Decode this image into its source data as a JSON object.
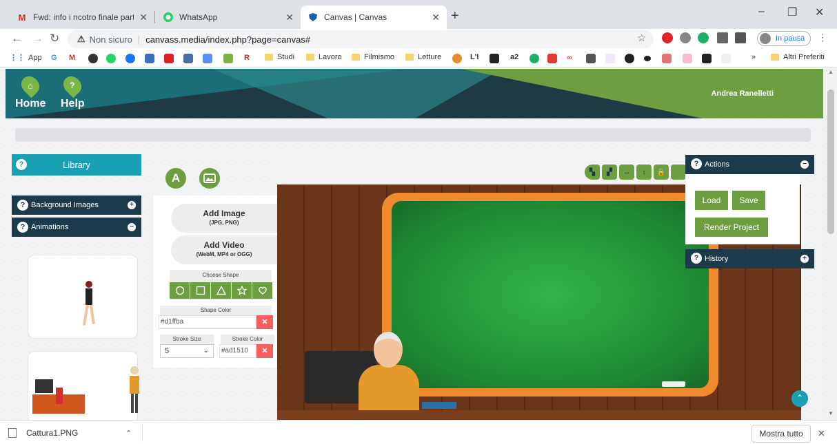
{
  "browser": {
    "tabs": [
      {
        "title": "Fwd: info i ncotro finale partner ;",
        "icon": "gmail-icon",
        "active": false
      },
      {
        "title": "WhatsApp",
        "icon": "whatsapp-icon",
        "active": false
      },
      {
        "title": "Canvas | Canvas",
        "icon": "shield-icon",
        "active": true
      }
    ],
    "new_tab": "+",
    "window_controls": {
      "minimize": "–",
      "restore": "❐",
      "close": "✕"
    },
    "address": {
      "security": "Non sicuro",
      "url": "canvass.media/index.php?page=canvas#"
    },
    "profile_label": "In pausa",
    "bookmarks": [
      {
        "label": "App",
        "type": "apps"
      },
      {
        "label": "Studi",
        "type": "folder"
      },
      {
        "label": "Lavoro",
        "type": "folder"
      },
      {
        "label": "Filmismo",
        "type": "folder"
      },
      {
        "label": "Letture",
        "type": "folder"
      },
      {
        "label": "L'I",
        "type": "site"
      },
      {
        "label": "a2",
        "type": "site"
      },
      {
        "label": "»",
        "type": "more"
      },
      {
        "label": "Altri Preferiti",
        "type": "folder"
      }
    ]
  },
  "header": {
    "nav": [
      {
        "label": "Home",
        "icon": "home-icon",
        "glyph": "⌂"
      },
      {
        "label": "Help",
        "icon": "help-icon",
        "glyph": "?"
      }
    ],
    "user": "Andrea Ranelletti"
  },
  "sidebar": {
    "library": "Library",
    "sections": [
      {
        "label": "Background Images",
        "toggle": "+"
      },
      {
        "label": "Animations",
        "toggle": "−"
      }
    ]
  },
  "tools": {
    "tab_text_glyph": "A",
    "add_image": {
      "label": "Add Image",
      "sub": "(JPG, PNG)"
    },
    "add_video": {
      "label": "Add Video",
      "sub": "(WebM, MP4 or OGG)"
    },
    "choose_shape": "Choose Shape",
    "shapes": [
      "circle",
      "square",
      "triangle",
      "star",
      "heart"
    ],
    "shape_color_label": "Shape Color",
    "shape_color_value": "#d1ffba",
    "stroke_size_label": "Stroke Size",
    "stroke_size_value": "5",
    "stroke_color_label": "Stroke Color",
    "stroke_color_value": "#ad1510",
    "clear_glyph": "✕"
  },
  "actions": {
    "title": "Actions",
    "toggle": "−",
    "buttons": {
      "load": "Load",
      "save": "Save",
      "render": "Render Project"
    }
  },
  "history": {
    "title": "History",
    "toggle": "+"
  },
  "download": {
    "filename": "Cattura1.PNG",
    "show_all": "Mostra tutto",
    "close": "✕"
  },
  "colors": {
    "accent_green": "#6d9e3f",
    "teal": "#19a0b4",
    "navy": "#1b3a4b",
    "danger": "#f55f5f"
  }
}
